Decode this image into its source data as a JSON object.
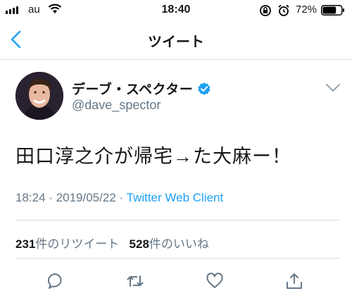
{
  "status_bar": {
    "carrier": "au",
    "time": "18:40",
    "battery_percent": "72%",
    "battery_level": 0.72
  },
  "nav": {
    "title": "ツイート"
  },
  "tweet": {
    "display_name": "デーブ・スペクター",
    "handle": "@dave_spector",
    "text": "田口淳之介が帰宅→た大麻ー！",
    "time": "18:24",
    "separator": "·",
    "date": "2019/05/22",
    "client": "Twitter Web Client"
  },
  "stats": {
    "retweet_count": "231",
    "retweet_label": "件のリツイート",
    "like_count": "528",
    "like_label": "件のいいね"
  },
  "colors": {
    "accent": "#1da1f2",
    "secondary_text": "#657786",
    "divider": "#d8dde2"
  }
}
